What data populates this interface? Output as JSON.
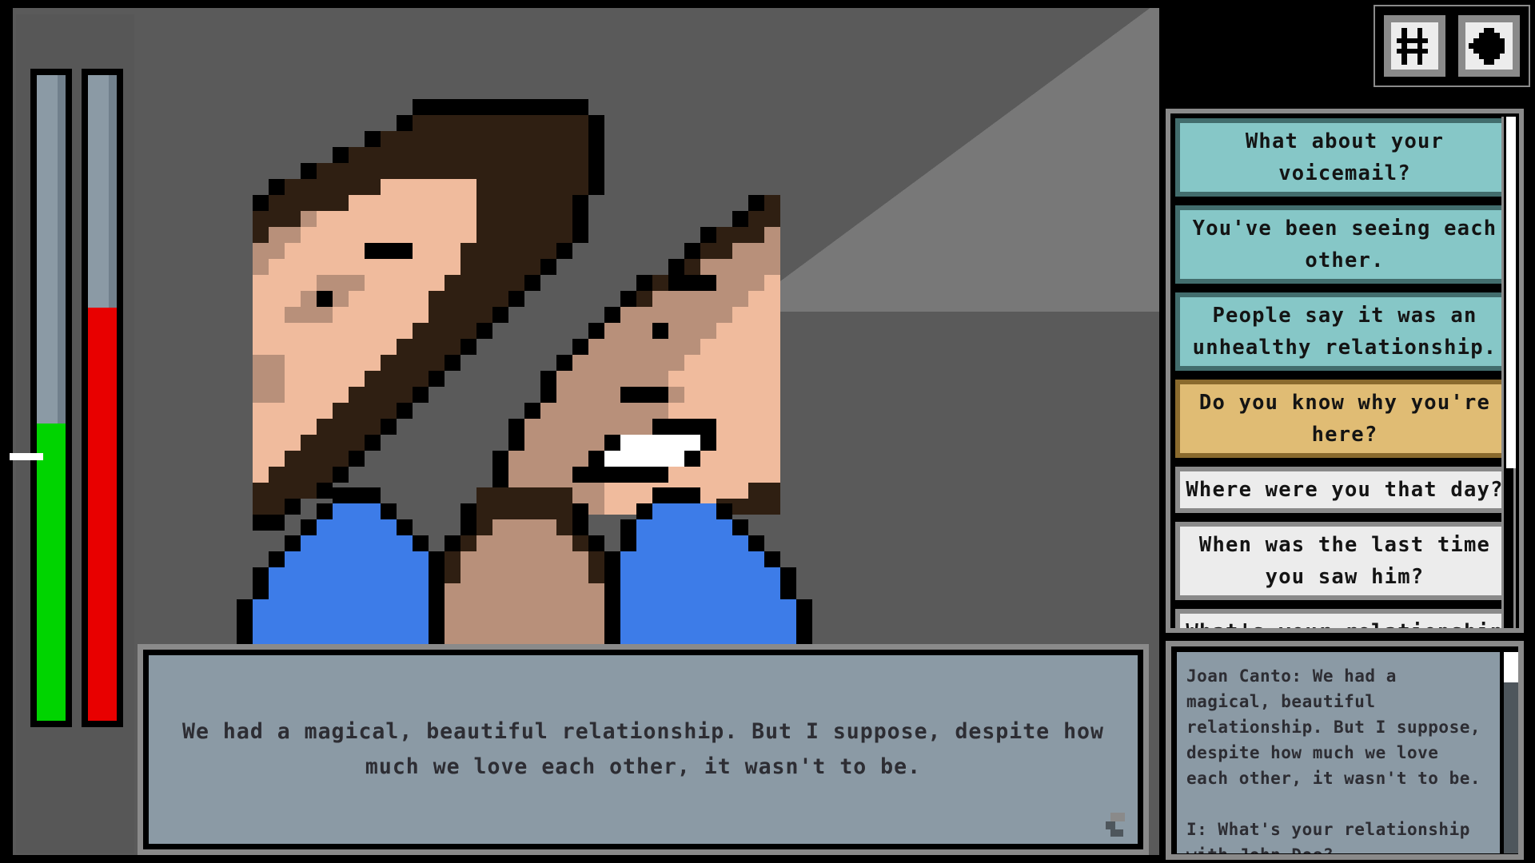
{
  "scene": {
    "background_color": "#787878",
    "background_shadow_color": "#5a5a5a",
    "character": {
      "name": "Joan Canto",
      "hair_color": "#2f1f12",
      "skin_light": "#f0bb9d",
      "skin_shade": "#b8907a",
      "shirt_color": "#3d7ce8",
      "outline_color": "#000000"
    }
  },
  "meters": {
    "green_meter": {
      "name": "composure-meter",
      "value_percent": 46,
      "color": "#00d400"
    },
    "red_meter": {
      "name": "stress-meter",
      "value_percent": 64,
      "color": "#e80000"
    },
    "tick_marker_color": "#ffffff",
    "track_color": "#8b9aa5"
  },
  "toolbar": {
    "buttons": [
      {
        "icon": "grid-icon",
        "label": ""
      },
      {
        "icon": "puzzle-piece-icon",
        "label": ""
      }
    ]
  },
  "options": {
    "scrollbar": {
      "thumb_color": "#ffffff",
      "position_percent": 0
    },
    "items": [
      {
        "label": "What about your voicemail?",
        "style": "teal"
      },
      {
        "label": "You've been seeing each other.",
        "style": "teal"
      },
      {
        "label": "People say it was an unhealthy relationship.",
        "style": "teal"
      },
      {
        "label": "Do you know why you're here?",
        "style": "gold"
      },
      {
        "label": "Where were you that day?",
        "style": "gray"
      },
      {
        "label": "When was the last time you saw him?",
        "style": "gray"
      },
      {
        "label": "What's your relationship with John Doe?",
        "style": "gray"
      },
      {
        "label": "",
        "style": "green"
      }
    ]
  },
  "dialogue": {
    "text": "We had a magical, beautiful relationship. But I suppose, despite how much we love each other, it wasn't to be.",
    "indicator": "continue-indicator"
  },
  "log": {
    "text": "Joan Canto: We had a magical, beautiful relationship. But I suppose, despite how much we love each other, it wasn't to be.\n\nI: What's your relationship with John Doe?",
    "scrollbar": {
      "thumb_color": "#ffffff"
    }
  }
}
